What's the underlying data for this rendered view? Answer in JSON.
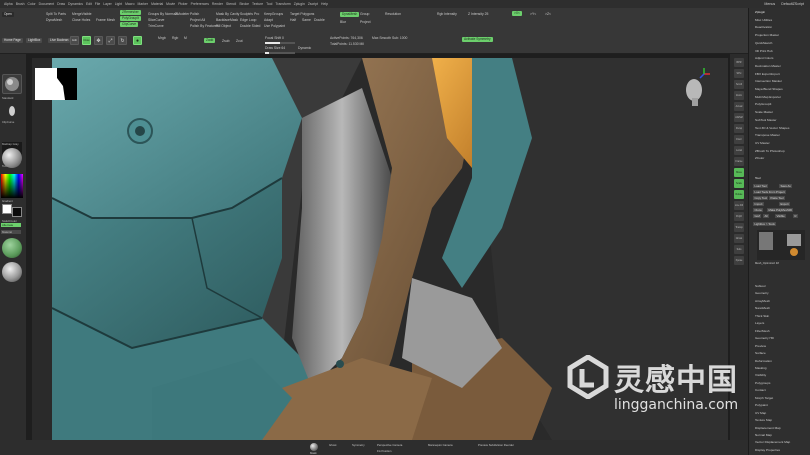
{
  "menubar": {
    "items": [
      "Alpha",
      "Brush",
      "Color",
      "Document",
      "Draw",
      "Dynamics",
      "Edit",
      "File",
      "Layer",
      "Light",
      "Macro",
      "Marker",
      "Material",
      "Movie",
      "Picker",
      "Preferences",
      "Render",
      "Stencil",
      "Stroke",
      "Texture",
      "Tool",
      "Transform",
      "Zplugin",
      "Zscript",
      "Help"
    ],
    "right": [
      "Menus",
      "DefaultZScript"
    ]
  },
  "shelf": {
    "open_label": "Open",
    "home_page": "Home Page",
    "lightbox": "LightBox",
    "live_boolean": "Live Boolean",
    "edit": "Edit",
    "draw": "Draw",
    "move": "Move",
    "scale": "Scale",
    "rotate": "Rotate",
    "mrgb": "Mrgb",
    "rgb": "Rgb",
    "m": "M",
    "zadd": "Zadd",
    "zsub": "Zsub",
    "zcut": "Zcut",
    "focal_shift_label": "Focal Shift",
    "focal_shift_value": "0",
    "draw_size_label": "Draw Size",
    "draw_size_value": "64",
    "dynamic": "Dynamic",
    "active_points": "ActivePoints: 764,306",
    "total_points": "TotalPoints: 11.530 Mil",
    "rgb_intensity": "Rgb Intensity",
    "z_intensity": "Z Intensity 25",
    "dynamesh": "DynaMesh",
    "group": "Group",
    "polish": "Polish",
    "blur": "Blur",
    "project": "Project",
    "resolution": "Resolution",
    "zremesher": "ZRemesher",
    "target_polygons": "Target Polygons",
    "adapt": "Adapt",
    "use_polypaint": "Use Polypaint",
    "keep_groups": "KeepGroups",
    "half": "Half",
    "same": "Same",
    "double": "Double",
    "activate_symmetry": "Activate Symmetry",
    "x": ">X<",
    "y": ">Y<",
    "z": ">Z<",
    "max_smooth_sub": "Max Smooth Sub: 1000",
    "split_to_parts": "Split To Parts",
    "merge_visible": "MergeVisible",
    "close_holes": "Close Holes",
    "groups_by_normals": "Groups By Normals",
    "polygroupit": "PolyGroupIt",
    "project_all": "Project All",
    "clip_curve": "ClipCurve",
    "polish_by_features": "Polish By Features",
    "mask_by_cavity": "Mask By Cavity",
    "backface_mask": "BackfaceMask",
    "fill_object": "Fill Object",
    "sculptris_pro": "Sculptris Pro",
    "edge_loop": "Edge Loop",
    "double_sided": "Double Sided",
    "dynamesh_status": "DynaMesh",
    "slice_curve": "SliceCurve",
    "trimcurve": "TrimCurve",
    "zmodeler": "ZModeler",
    "frame_mesh": "Frame Mesh"
  },
  "leftshelf": {
    "items": [
      "Standard",
      "ClipCurve",
      "Alpha Off",
      "Texture Off",
      "MatCap Gray",
      "Gradient",
      "SwitchColor",
      "Alternate",
      "Material"
    ]
  },
  "rightshelf": {
    "items": [
      "BPR",
      "SPix",
      "Scroll",
      "Zoom",
      "Actual",
      "AAHalf",
      "Persp",
      "Floor",
      "Local",
      "Frame",
      "Move",
      "Scale",
      "Rotate",
      "Line Fill",
      "PolyF",
      "Transp",
      "Ghost",
      "Solo",
      "Xpose"
    ]
  },
  "palette": {
    "top": [
      "Zplugin",
      "Misc Utilities",
      "Deactivation",
      "Projection Master",
      "QuickSketch",
      "3D Print Hub",
      "Adjust Colors",
      "Decimation Master",
      "FBX ExportImport",
      "Intersection Masker",
      "Maya Blend Shapes",
      "Multi Map Exporter",
      "PolyGroupIt",
      "Scale Master",
      "SubTool Master",
      "Text 3D & Vector Shapes",
      "Transpose Master",
      "UV Master",
      "ZBrush To Photoshop",
      "ZColor"
    ],
    "tool_header": "Tool",
    "tool_buttons": [
      "Load Tool",
      "Save As",
      "Load Tools From Project",
      "Copy Tool",
      "Paste Tool",
      "Import",
      "Export",
      "Clone",
      "Make PolyMesh3D",
      "GoZ",
      "All",
      "Visible",
      "R",
      "Lightbox > Tools"
    ],
    "mesh_label": "Mesh_Optimized: 48",
    "subpanels": [
      "Subtool",
      "Geometry",
      "ArrayMesh",
      "NanoMesh",
      "Thick Skin",
      "Layers",
      "FiberMesh",
      "Geometry HD",
      "Preview",
      "Surface",
      "Deformation",
      "Masking",
      "Visibility",
      "Polygroups",
      "Contact",
      "Morph Target",
      "Polypaint",
      "UV Map",
      "Texture Map",
      "Displacement Map",
      "Normal Map",
      "Vector Displacement Map",
      "Display Properties"
    ]
  },
  "bottombar": {
    "items": [
      "Mask",
      "Ghost",
      "Symmetry",
      "Perspective Camera",
      "Mannequin Camera",
      "Fix Position",
      "Preview Subdivision Reorder",
      "Perspective Camera",
      "Fix Position",
      "Perspective Subdivision Reorder 4%"
    ]
  },
  "watermark": {
    "chinese": "灵感中国",
    "url": "lingganchina.com"
  },
  "colors": {
    "accent_green": "#6ccf6c",
    "armor_teal": "#4f8e92",
    "armor_bronze": "#8a6a49",
    "armor_gold": "#d99a3a",
    "metal_gray": "#8c8c8c"
  }
}
